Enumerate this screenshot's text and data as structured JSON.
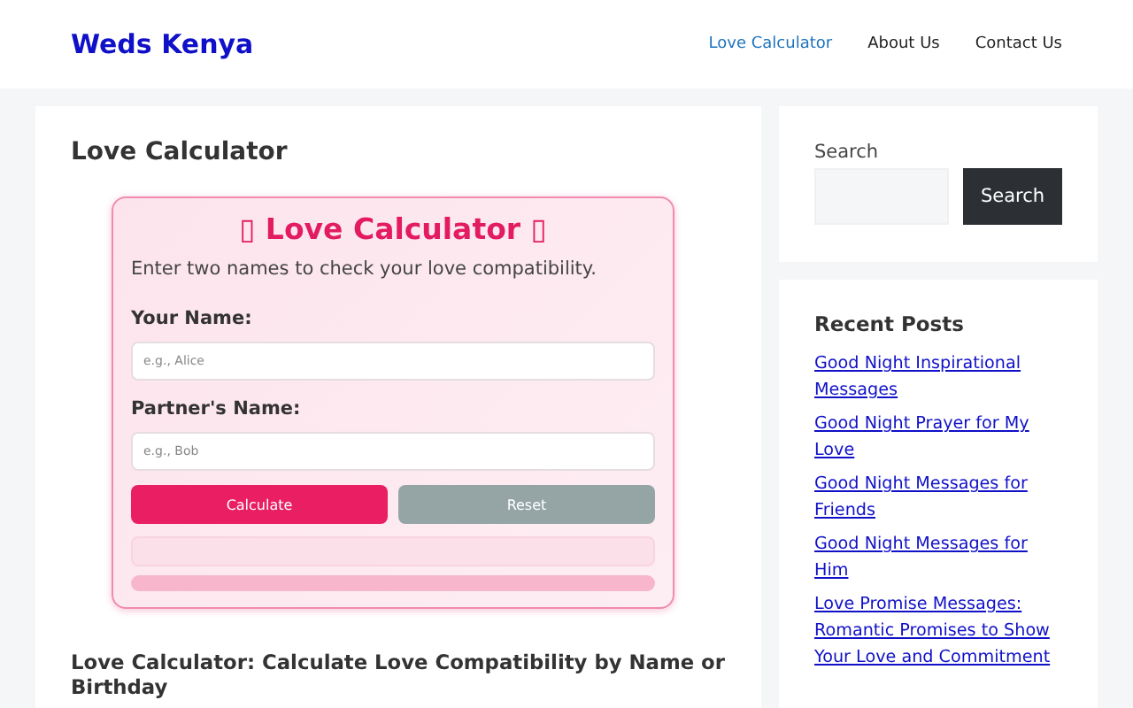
{
  "header": {
    "logo": "Weds Kenya",
    "nav": [
      {
        "label": "Love Calculator",
        "selected": true
      },
      {
        "label": "About Us",
        "selected": false
      },
      {
        "label": "Contact Us",
        "selected": false
      }
    ]
  },
  "article": {
    "title": "Love Calculator",
    "calculator": {
      "title": "▯ Love Calculator ▯",
      "subtitle": "Enter two names to check your love compatibility.",
      "fields": [
        {
          "label": "Your Name:",
          "placeholder": "e.g., Alice"
        },
        {
          "label": "Partner's Name:",
          "placeholder": "e.g., Bob"
        }
      ],
      "buttons": [
        {
          "label": "Calculate",
          "kind": "primary"
        },
        {
          "label": "Reset",
          "kind": "secondary"
        }
      ],
      "progress": {
        "level": 0
      }
    },
    "heading": "Love Calculator: Calculate Love Compatibility by Name or Birthday"
  },
  "sidebar": {
    "search": {
      "label": "Search",
      "button": "Search"
    },
    "recent_posts": {
      "title": "Recent Posts",
      "items": [
        "Good Night Inspirational Messages",
        "Good Night Prayer for My Love",
        "Good Night Messages for Friends",
        "Good Night Messages for Him",
        "Love Promise Messages: Romantic Promises to Show Your Love and Commitment"
      ]
    }
  }
}
